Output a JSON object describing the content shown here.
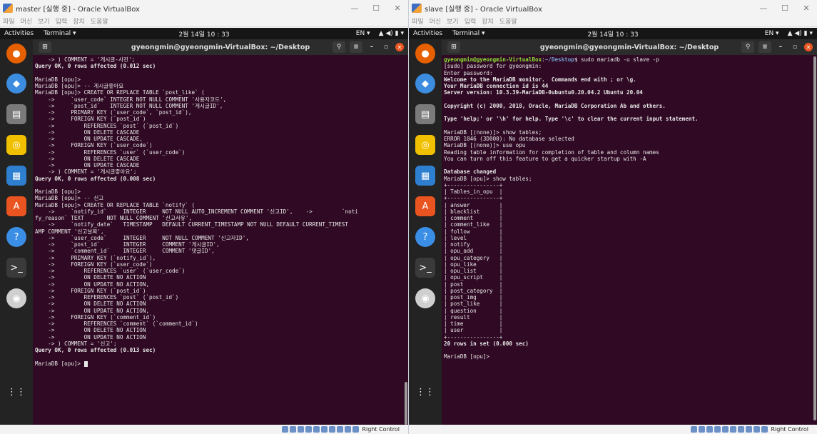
{
  "left": {
    "window_title": "master [실행 중] - Oracle VirtualBox",
    "menu": [
      "파일",
      "머신",
      "보기",
      "입력",
      "장치",
      "도움말"
    ],
    "topbar": {
      "activities": "Activities",
      "app": "Terminal ▾",
      "clock": "2월 14일 10 : 33",
      "lang": "EN ▾",
      "sys": "▲ ◀) ▮ ▾"
    },
    "terminal_title": "gyeongmin@gyeongmin-VirtualBox: ~/Desktop",
    "lines": [
      "    -> ) COMMENT = '게시글-사진';",
      "Query OK, 0 rows affected (0.012 sec)",
      "",
      "MariaDB [opu]>",
      "MariaDB [opu]> -- 게시글좋아요",
      "MariaDB [opu]> CREATE OR REPLACE TABLE `post_like` (",
      "    ->     `user_code` INTEGER NOT NULL COMMENT '사용자코드',",
      "    ->     `post_id`   INTEGER NOT NULL COMMENT '게시글ID',",
      "    ->     PRIMARY KEY (`user_code`, `post_id`),",
      "    ->     FOREIGN KEY (`post_id`)",
      "    ->         REFERENCES `post` (`post_id`)",
      "    ->         ON DELETE CASCADE",
      "    ->         ON UPDATE CASCADE,",
      "    ->     FOREIGN KEY (`user_code`)",
      "    ->         REFERENCES `user` (`user_code`)",
      "    ->         ON DELETE CASCADE",
      "    ->         ON UPDATE CASCADE",
      "    -> ) COMMENT = '게시글좋아요';",
      "Query OK, 0 rows affected (0.008 sec)",
      "",
      "MariaDB [opu]>",
      "MariaDB [opu]> -- 신고",
      "MariaDB [opu]> CREATE OR REPLACE TABLE `notify` (",
      "    ->     `notify_id`     INTEGER     NOT NULL AUTO_INCREMENT COMMENT '신고ID',    ->         `noti",
      "fy_reason` TEXT       NOT NULL COMMENT '신고사유',",
      "    ->     `notify_date`   TIMESTAMP   DEFAULT CURRENT_TIMESTAMP NOT NULL DEFAULT CURRENT_TIMEST",
      "AMP COMMENT '신고날짜',",
      "    ->     `user_code`     INTEGER     NOT NULL COMMENT '신고자ID',",
      "    ->     `post_id`       INTEGER     COMMENT '게시글ID',",
      "    ->     `comment_id`    INTEGER     COMMENT '댓글ID',",
      "    ->     PRIMARY KEY (`notify_id`),",
      "    ->     FOREIGN KEY (`user_code`)",
      "    ->         REFERENCES `user` (`user_code`)",
      "    ->         ON DELETE NO ACTION",
      "    ->         ON UPDATE NO ACTION,",
      "    ->     FOREIGN KEY (`post_id`)",
      "    ->         REFERENCES `post` (`post_id`)",
      "    ->         ON DELETE NO ACTION",
      "    ->         ON UPDATE NO ACTION,",
      "    ->     FOREIGN KEY (`comment_id`)",
      "    ->         REFERENCES `comment` (`comment_id`)",
      "    ->         ON DELETE NO ACTION",
      "    ->         ON UPDATE NO ACTION",
      "    -> ) COMMENT = '신고';",
      "Query OK, 0 rows affected (0.013 sec)",
      "",
      "MariaDB [opu]> "
    ],
    "bold_lines": [
      1,
      18,
      44
    ],
    "status_text": "Right Control"
  },
  "right": {
    "window_title": "slave [실행 중] - Oracle VirtualBox",
    "menu": [
      "파일",
      "머신",
      "보기",
      "입력",
      "장치",
      "도움말"
    ],
    "topbar": {
      "activities": "Activities",
      "app": "Terminal ▾",
      "clock": "2월 14일 10 : 33",
      "lang": "EN ▾",
      "sys": "▲ ◀) ▮ ▾"
    },
    "terminal_title": "gyeongmin@gyeongmin-VirtualBox: ~/Desktop",
    "prompt": {
      "user": "gyeongmin@gyeongmin-VirtualBox",
      "sep": ":",
      "path": "~/Desktop",
      "cmd": "$ sudo mariadb -u slave -p"
    },
    "lines": [
      "[sudo] password for gyeongmin:",
      "Enter password:",
      "Welcome to the MariaDB monitor.  Commands end with ; or \\g.",
      "Your MariaDB connection id is 44",
      "Server version: 10.3.39-MariaDB-0ubuntu0.20.04.2 Ubuntu 20.04",
      "",
      "Copyright (c) 2000, 2018, Oracle, MariaDB Corporation Ab and others.",
      "",
      "Type 'help;' or '\\h' for help. Type '\\c' to clear the current input statement.",
      "",
      "MariaDB [(none)]> show tables;",
      "ERROR 1046 (3D000): No database selected",
      "MariaDB [(none)]> use opu",
      "Reading table information for completion of table and column names",
      "You can turn off this feature to get a quicker startup with -A",
      "",
      "Database changed",
      "MariaDB [opu]> show tables;",
      "+----------------+",
      "| Tables_in_opu  |",
      "+----------------+",
      "| answer         |",
      "| blacklist      |",
      "| comment        |",
      "| comment_like   |",
      "| follow         |",
      "| level          |",
      "| notify         |",
      "| opu_add        |",
      "| opu_category   |",
      "| opu_like       |",
      "| opu_list       |",
      "| opu_script     |",
      "| post           |",
      "| post_category  |",
      "| post_img       |",
      "| post_like      |",
      "| question       |",
      "| result         |",
      "| time           |",
      "| user           |",
      "+----------------+",
      "20 rows in set (0.000 sec)",
      "",
      "MariaDB [opu]>"
    ],
    "bold_lines": [
      2,
      3,
      4,
      6,
      8,
      16,
      42
    ],
    "status_text": "Right Control"
  },
  "dock_icons": [
    "firefox-icon",
    "thunderbird-icon",
    "files-icon",
    "rhythmbox-icon",
    "writer-icon",
    "software-icon",
    "help-icon",
    "terminal-icon",
    "disc-icon",
    "apps-grid-icon"
  ],
  "dock_glyphs": [
    "●",
    "◆",
    "▤",
    "◎",
    "▦",
    "A",
    "?",
    ">_",
    "◉",
    "⋮⋮"
  ],
  "colors": {
    "terminal_bg": "#300a24",
    "prompt_user": "#8ae234",
    "prompt_path": "#729fcf",
    "accent": "#e95420"
  }
}
